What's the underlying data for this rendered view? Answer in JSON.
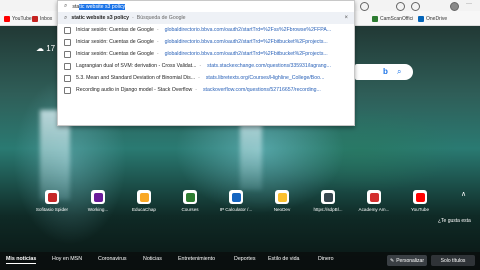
{
  "favorites": [
    {
      "label": "YouTube",
      "color": "#ff0000"
    },
    {
      "label": "Inbox",
      "color": "#c5221f"
    },
    {
      "label": "CamScanOffici",
      "color": "#2e7d32"
    },
    {
      "label": "OneDrive",
      "color": "#0364b8"
    }
  ],
  "address_bar": {
    "typed_prefix": "sta",
    "autocomplete": "tic website s3 policy"
  },
  "suggestions": [
    {
      "title": "static website s3 policy",
      "separator": "-",
      "source": "Búsqueda de Google",
      "kind": "search"
    },
    {
      "title": "Iniciar sesión: Cuentas de Google",
      "separator": "-",
      "url": "globaldirectorio.bbva.com/oauth2/startTrd=%2Fss%2Fbrowse%2FFPA...",
      "kind": "page"
    },
    {
      "title": "Iniciar sesión: Cuentas de Google",
      "separator": "-",
      "url": "globaldirectorio.bbva.com/oauth2/startTrd=%2Fbitbucket%2Fprojects...",
      "kind": "page"
    },
    {
      "title": "Iniciar sesión: Cuentas de Google",
      "separator": "-",
      "url": "globaldirectorio.bbva.com/oauth2/startTrd=%2Fbitbucket%2Fprojects...",
      "kind": "page"
    },
    {
      "title": "Lagrangian dual of SVM: derivation - Cross Validat...",
      "separator": "-",
      "url": "stats.stackexchange.com/questions/335931/lagrang...",
      "kind": "page"
    },
    {
      "title": "5.3. Mean and Standard Deviation of Binomial Dis...",
      "separator": "-",
      "url": "stats.libretexts.org/Courses/Highline_College/Boo...",
      "kind": "page"
    },
    {
      "title": "Recording audio in Django model - Stack Overflow",
      "separator": "-",
      "url": "stackoverflow.com/questions/52716657/recording...",
      "kind": "page"
    }
  ],
  "weather": {
    "temp": "17"
  },
  "tiles": [
    {
      "label": "Sofitasio Spider",
      "color": "#c62828"
    },
    {
      "label": "Working...",
      "color": "#6a1b9a"
    },
    {
      "label": "EducaChap",
      "color": "#f9a825"
    },
    {
      "label": "Courses",
      "color": "#2e7d32"
    },
    {
      "label": "IP Calculator /...",
      "color": "#1565c0"
    },
    {
      "label": "NeoDev",
      "color": "#fbc02d"
    },
    {
      "label": "https://sdpBl...",
      "color": "#37474f"
    },
    {
      "label": "Academy Am...",
      "color": "#d32f2f"
    },
    {
      "label": "YouTube",
      "color": "#ff0000"
    }
  ],
  "like_text": "¿Te gusta esta",
  "news_tabs": [
    "Mis noticias",
    "Hoy en MSN",
    "Coronavirus",
    "Noticias",
    "Entretenimiento",
    "Deportes",
    "Estilo de vida",
    "Dinero"
  ],
  "personalize": "Personalizar",
  "solo_titles": "Solo títulos"
}
